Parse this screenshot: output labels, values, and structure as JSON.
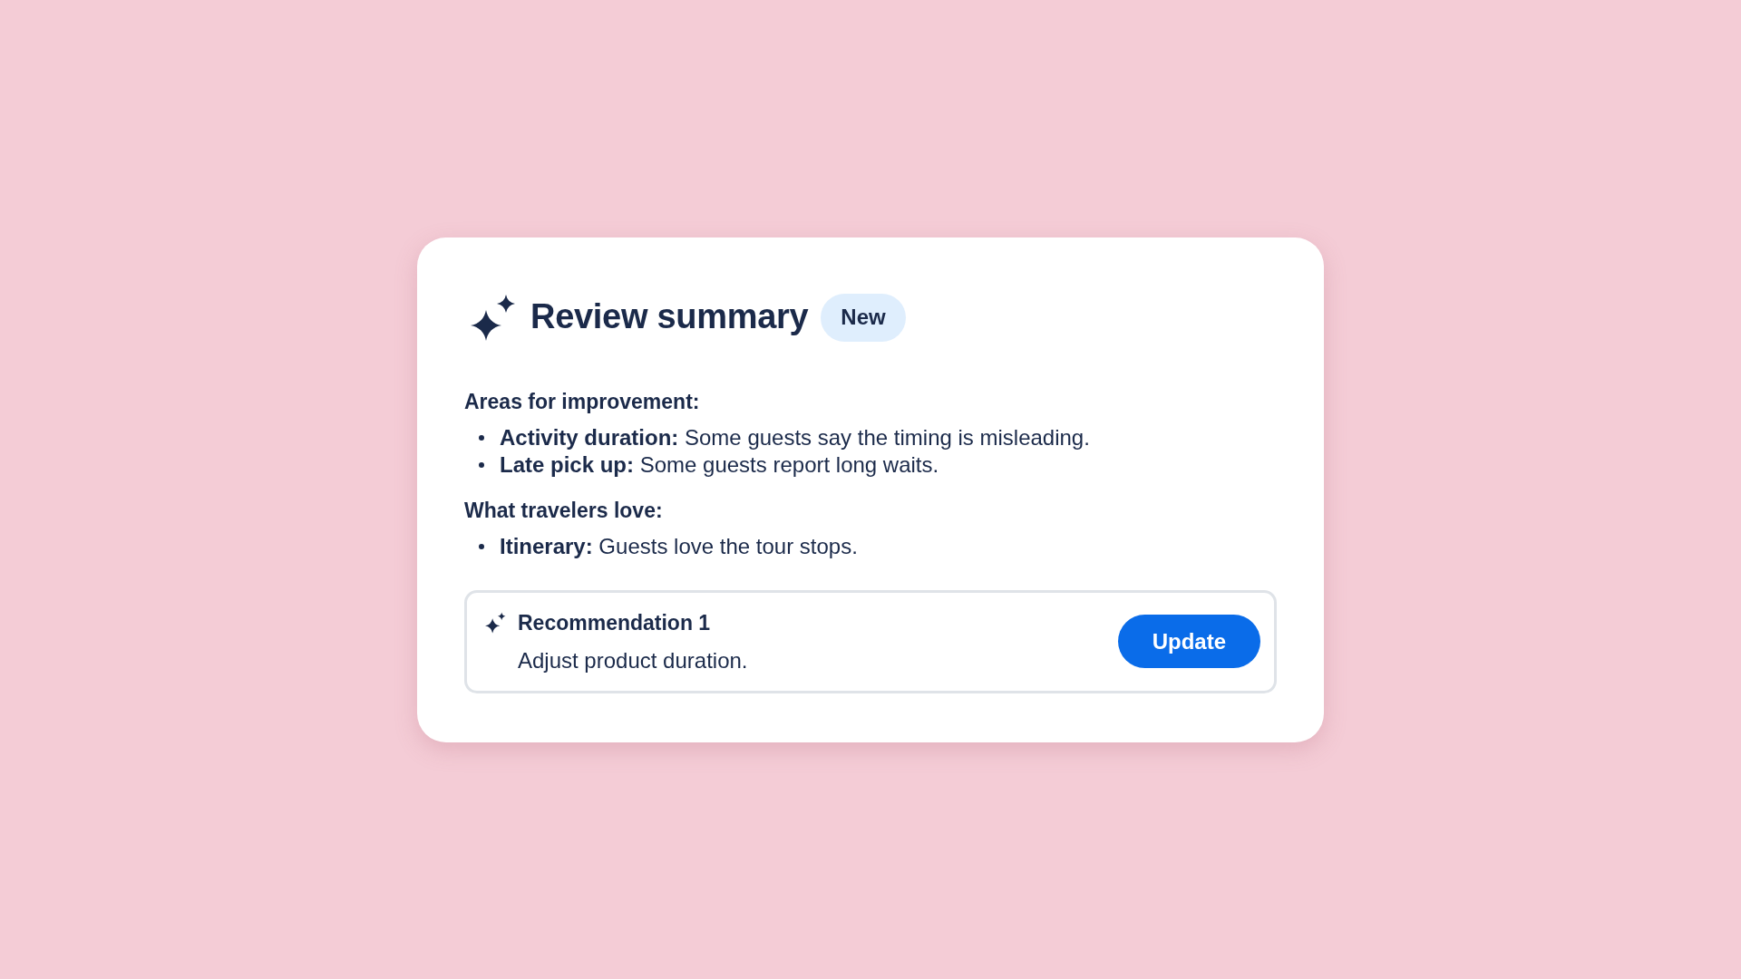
{
  "card": {
    "title": "Review summary",
    "badge": "New"
  },
  "sections": [
    {
      "heading": "Areas for improvement:",
      "items": [
        "**Activity duration:** Some guests say the timing is misleading.",
        "**Late pick up:** Some guests report long waits."
      ]
    },
    {
      "heading": "What travelers love:",
      "items": [
        "**Itinerary:** Guests love the tour stops."
      ]
    }
  ],
  "recommendation": {
    "title": "Recommendation 1",
    "text": "Adjust product duration.",
    "button": "Update"
  }
}
